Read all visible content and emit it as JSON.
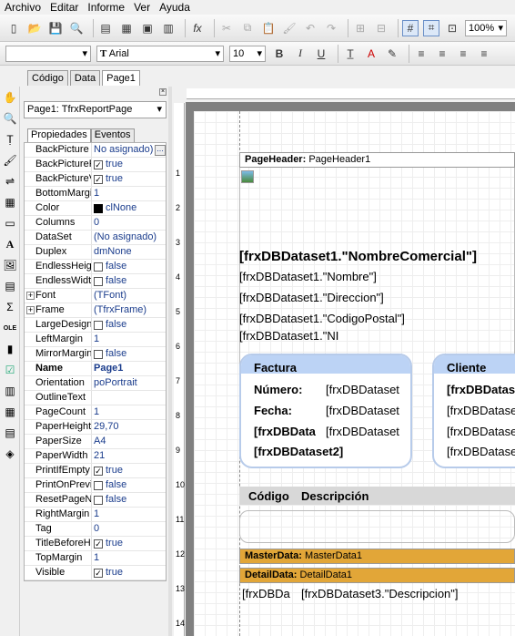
{
  "menu": [
    "Archivo",
    "Editar",
    "Informe",
    "Ver",
    "Ayuda"
  ],
  "toolbar": {
    "zoom": "100%",
    "font": "Arial",
    "size": "10",
    "style_empty": ""
  },
  "doc_tabs": [
    "Código",
    "Data",
    "Page1"
  ],
  "inspector": {
    "object": "Page1: TfrxReportPage",
    "tabs": [
      "Propiedades",
      "Eventos"
    ],
    "rows": [
      {
        "n": "BackPicture",
        "v": "No asignado)",
        "t": "dots"
      },
      {
        "n": "BackPicturePr",
        "v": "true",
        "t": "cb",
        "c": true
      },
      {
        "n": "BackPictureVi",
        "v": "true",
        "t": "cb",
        "c": true
      },
      {
        "n": "BottomMargin",
        "v": "1"
      },
      {
        "n": "Color",
        "v": "clNone",
        "t": "sw"
      },
      {
        "n": "Columns",
        "v": "0"
      },
      {
        "n": "DataSet",
        "v": "(No asignado)"
      },
      {
        "n": "Duplex",
        "v": "dmNone"
      },
      {
        "n": "EndlessHeigh",
        "v": "false",
        "t": "cb",
        "c": false
      },
      {
        "n": "EndlessWidth",
        "v": "false",
        "t": "cb",
        "c": false
      },
      {
        "n": "Font",
        "v": "(TFont)",
        "t": "exp"
      },
      {
        "n": "Frame",
        "v": "(TfrxFrame)",
        "t": "exp"
      },
      {
        "n": "LargeDesignH",
        "v": "false",
        "t": "cb",
        "c": false
      },
      {
        "n": "LeftMargin",
        "v": "1"
      },
      {
        "n": "MirrorMargins",
        "v": "false",
        "t": "cb",
        "c": false
      },
      {
        "n": "Name",
        "v": "Page1",
        "b": true
      },
      {
        "n": "Orientation",
        "v": "poPortrait"
      },
      {
        "n": "OutlineText",
        "v": ""
      },
      {
        "n": "PageCount",
        "v": "1"
      },
      {
        "n": "PaperHeight",
        "v": "29,70"
      },
      {
        "n": "PaperSize",
        "v": "A4"
      },
      {
        "n": "PaperWidth",
        "v": "21"
      },
      {
        "n": "PrintIfEmpty",
        "v": "true",
        "t": "cb",
        "c": true
      },
      {
        "n": "PrintOnPrevio",
        "v": "false",
        "t": "cb",
        "c": false
      },
      {
        "n": "ResetPageNu",
        "v": "false",
        "t": "cb",
        "c": false
      },
      {
        "n": "RightMargin",
        "v": "1"
      },
      {
        "n": "Tag",
        "v": "0"
      },
      {
        "n": "TitleBeforeHe",
        "v": "true",
        "t": "cb",
        "c": true
      },
      {
        "n": "TopMargin",
        "v": "1"
      },
      {
        "n": "Visible",
        "v": "true",
        "t": "cb",
        "c": true
      }
    ]
  },
  "ruler_v": [
    "1",
    "2",
    "3",
    "4",
    "5",
    "6",
    "7",
    "8",
    "9",
    "10",
    "11",
    "12",
    "13",
    "14"
  ],
  "report": {
    "page_header_label": "PageHeader:",
    "page_header_name": "PageHeader1",
    "nombre_comercial": "[frxDBDataset1.\"NombreComercial\"]",
    "nombre": "[frxDBDataset1.\"Nombre\"]",
    "direccion": "[frxDBDataset1.\"Direccion\"]",
    "codigo_postal": "[frxDBDataset1.\"CodigoPostal\"]",
    "ni": "[frxDBDataset1.\"NI",
    "factura_title": "Factura",
    "numero_label": "Número:",
    "numero_value": "[frxDBDataset",
    "fecha_label": "Fecha:",
    "fecha_value": "[frxDBDataset",
    "bold_field1": "[frxDBData",
    "field3": "[frxDBDataset",
    "bold_field2": "[frxDBDataset2]",
    "cliente_title": "Cliente",
    "cliente_f1": "[frxDBDatase",
    "cliente_f2": "[frxDBDatase",
    "cliente_f3": "[frxDBDatase",
    "cliente_f4": "[frxDBDatase",
    "col_codigo": "Código",
    "col_descripcion": "Descripción",
    "master_label": "MasterData:",
    "master_name": "MasterData1",
    "detail_label": "DetailData:",
    "detail_name": "DetailData1",
    "detail_f1": "[frxDBDa",
    "detail_f2": "[frxDBDataset3.\"Descripcion\"]"
  },
  "colors": {
    "band_orange": "#e2a638",
    "rounded_head": "#bcd3f5"
  }
}
